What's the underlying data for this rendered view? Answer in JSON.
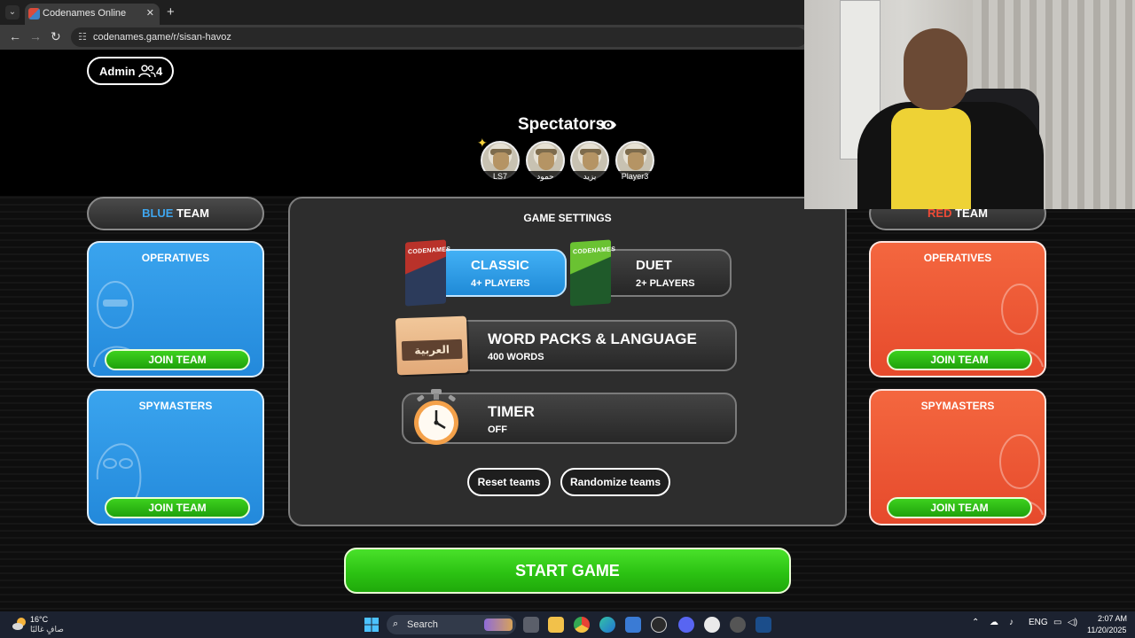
{
  "browser": {
    "tab_title": "Codenames Online",
    "tab_close": "✕",
    "new_tab": "+",
    "menu": "⌄",
    "back": "←",
    "forward": "→",
    "reload": "↻",
    "url": "codenames.game/r/sisan-havoz"
  },
  "header": {
    "admin_label": "Admin",
    "player_count": "4"
  },
  "spectators": {
    "title": "Spectators",
    "players": [
      "LS7",
      "حمود",
      "يزيد",
      "Player3"
    ]
  },
  "blue_team": {
    "header_color_word": "BLUE",
    "header_word": "TEAM",
    "operatives_title": "OPERATIVES",
    "spymasters_title": "SPYMASTERS",
    "join_label": "JOIN TEAM",
    "color": "#2b95e4"
  },
  "red_team": {
    "header_color_word": "RED",
    "header_word": "TEAM",
    "operatives_title": "OPERATIVES",
    "spymasters_title": "SPYMASTERS",
    "join_label": "JOIN TEAM",
    "color": "#ec5634"
  },
  "settings": {
    "title": "GAME SETTINGS",
    "modes": [
      {
        "name": "CLASSIC",
        "sub": "4+ PLAYERS",
        "box_label": "CODENAMES",
        "selected": true
      },
      {
        "name": "DUET",
        "sub": "2+ PLAYERS",
        "box_label": "CODENAMES",
        "selected": false
      }
    ],
    "word_packs": {
      "title": "WORD PACKS & LANGUAGE",
      "sub": "400 WORDS",
      "language_badge": "العربية"
    },
    "timer": {
      "title": "TIMER",
      "sub": "OFF"
    },
    "reset_label": "Reset teams",
    "randomize_label": "Randomize teams"
  },
  "start_label": "START GAME",
  "taskbar": {
    "temp": "16°C",
    "weather": "صافٍ غالبًا",
    "search_label": "Search",
    "lang": "ENG",
    "time": "2:07 AM",
    "date": "11/20/2025"
  }
}
